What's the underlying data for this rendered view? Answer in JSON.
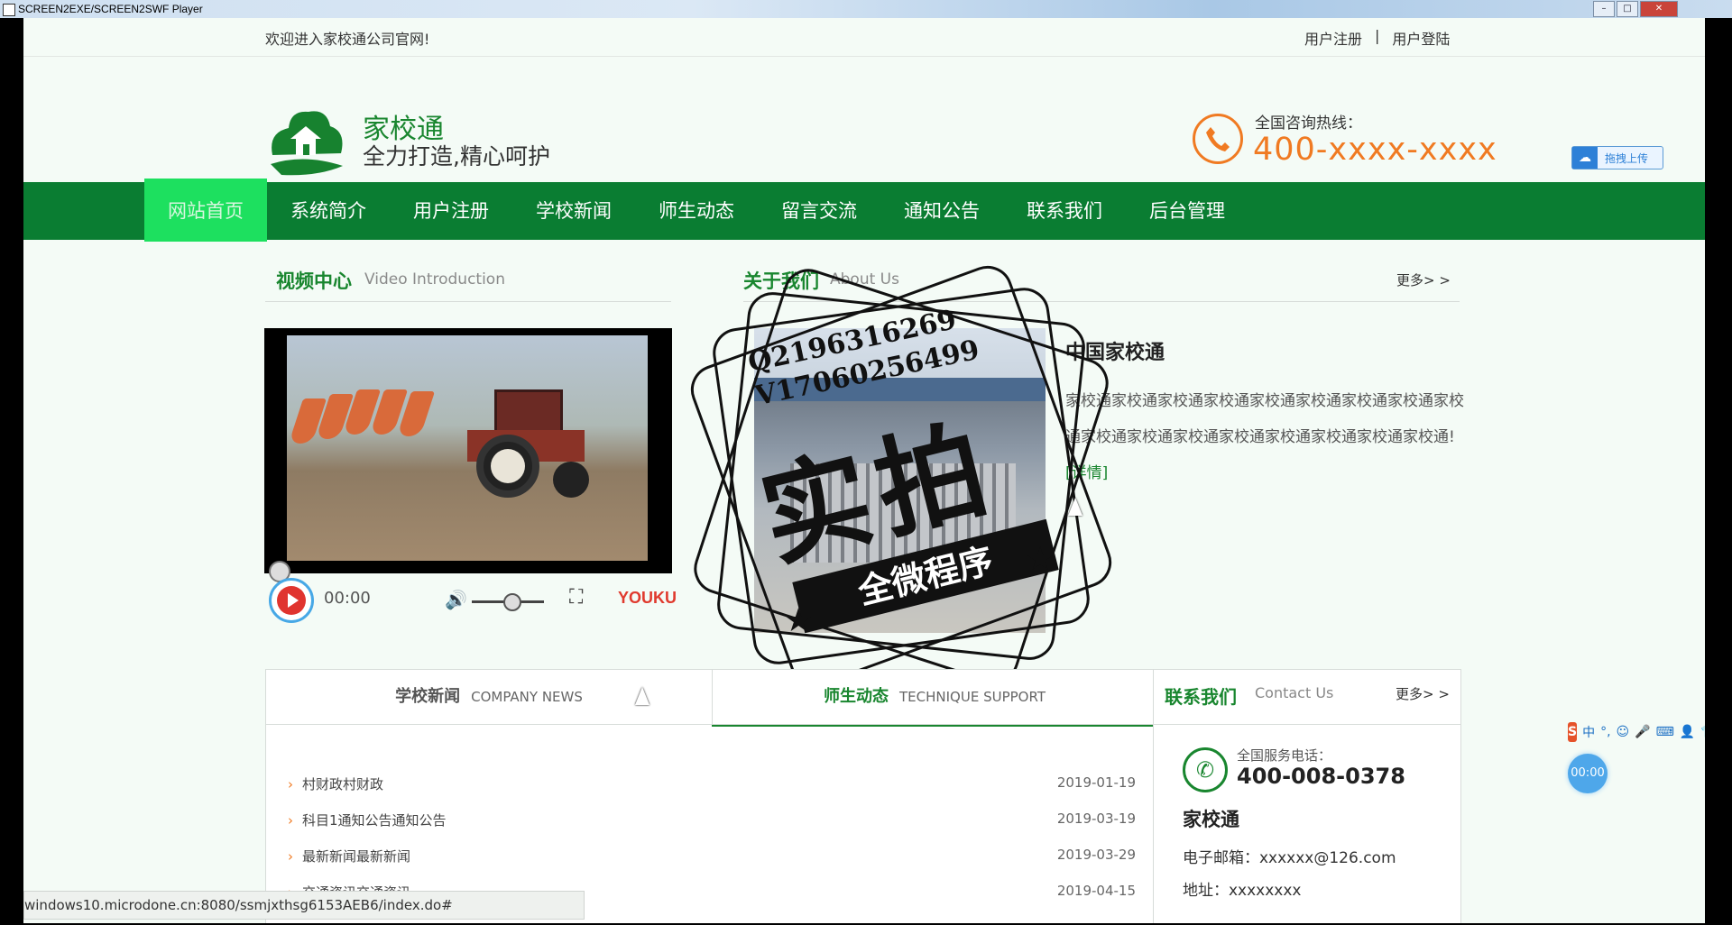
{
  "window": {
    "title": "SCREEN2EXE/SCREEN2SWF Player"
  },
  "topbar": {
    "welcome": "欢迎进入家校通公司官网!",
    "register": "用户注册",
    "separator": "|",
    "login": "用户登陆"
  },
  "header": {
    "brand_name": "家校通",
    "slogan": "全力打造,精心呵护",
    "hotline_label": "全国咨询热线：",
    "hotline_number": "400-xxxx-xxxx",
    "upload_label": "拖拽上传"
  },
  "nav": {
    "items": [
      {
        "label": "网站首页",
        "active": true
      },
      {
        "label": "系统简介"
      },
      {
        "label": "用户注册"
      },
      {
        "label": "学校新闻"
      },
      {
        "label": "师生动态"
      },
      {
        "label": "留言交流"
      },
      {
        "label": "通知公告"
      },
      {
        "label": "联系我们"
      },
      {
        "label": "后台管理"
      }
    ]
  },
  "video_section": {
    "title": "视频中心",
    "subtitle": "Video Introduction",
    "time": "00:00",
    "brand": "YOUKU"
  },
  "about_section": {
    "title": "关于我们",
    "subtitle": "About Us",
    "more": "更多> >",
    "heading": "中国家校通",
    "text": "家校通家校通家校通家校通家校通家校通家校通家校通家校通家校通家校通家校通家校通家校通家校通家校通家校通!",
    "detail_link": "[详情]"
  },
  "watermark": {
    "contact_line1": "Q2196316269",
    "contact_line2": "V17060256499",
    "main_text": "实拍",
    "banner_text": "全微程序"
  },
  "news_tabs": {
    "tabs": [
      {
        "cn": "学校新闻",
        "en": "COMPANY NEWS",
        "active": false
      },
      {
        "cn": "师生动态",
        "en": "TECHNIQUE SUPPORT",
        "active": true
      }
    ],
    "rows": [
      {
        "title": "村财政村财政",
        "date": "2019-01-19"
      },
      {
        "title": "科目1通知公告通知公告",
        "date": "2019-03-19"
      },
      {
        "title": "最新新闻最新新闻",
        "date": "2019-03-29"
      },
      {
        "title": "交通资讯交通资讯",
        "date": "2019-04-15"
      }
    ]
  },
  "contact": {
    "title": "联系我们",
    "subtitle": "Contact Us",
    "more": "更多> >",
    "service_label": "全国服务电话：",
    "service_number": "400-008-0378",
    "org": "家校通",
    "email": "电子邮箱：xxxxxx@126.com",
    "address": "地址：xxxxxxxx"
  },
  "statusbar": {
    "url": "windows10.microdone.cn:8080/ssmjxthsg6153AEB6/index.do#"
  },
  "overlay": {
    "ime_logo": "S",
    "ime_mode": "中",
    "timer": "00:00"
  },
  "colors": {
    "brand_green": "#0a7d32",
    "nav_active": "#1de05f",
    "hotline_orange": "#f07a22"
  }
}
